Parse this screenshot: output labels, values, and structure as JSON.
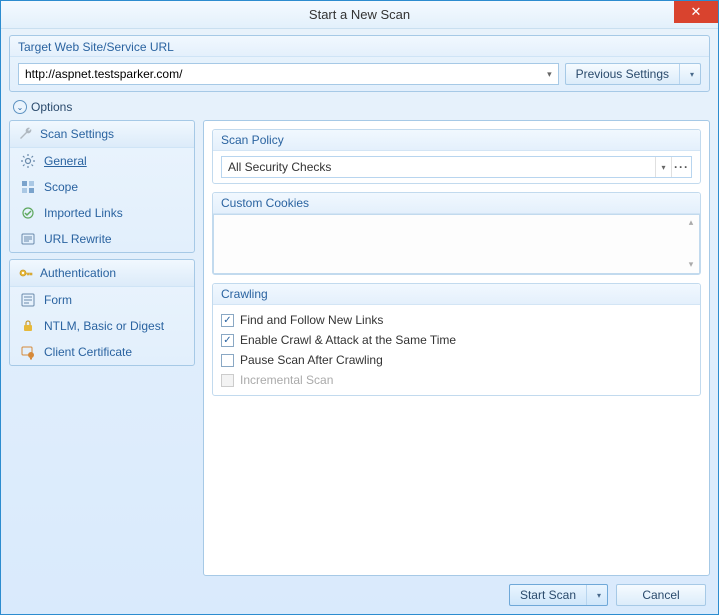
{
  "window": {
    "title": "Start a New Scan"
  },
  "target": {
    "label": "Target Web Site/Service URL",
    "url": "http://aspnet.testsparker.com/",
    "previous_settings_label": "Previous Settings"
  },
  "options": {
    "toggle_label": "Options"
  },
  "sidebar": {
    "scan_settings": {
      "header": "Scan Settings",
      "items": [
        {
          "label": "General",
          "icon": "gear-icon",
          "active": true
        },
        {
          "label": "Scope",
          "icon": "scope-icon"
        },
        {
          "label": "Imported Links",
          "icon": "links-icon"
        },
        {
          "label": "URL Rewrite",
          "icon": "rewrite-icon"
        }
      ]
    },
    "authentication": {
      "header": "Authentication",
      "items": [
        {
          "label": "Form",
          "icon": "form-icon"
        },
        {
          "label": "NTLM, Basic or Digest",
          "icon": "lock-icon"
        },
        {
          "label": "Client Certificate",
          "icon": "certificate-icon"
        }
      ]
    }
  },
  "scan_policy": {
    "header": "Scan Policy",
    "value": "All Security Checks"
  },
  "custom_cookies": {
    "header": "Custom Cookies",
    "value": ""
  },
  "crawling": {
    "header": "Crawling",
    "options": [
      {
        "label": "Find and Follow New Links",
        "checked": true,
        "disabled": false
      },
      {
        "label": "Enable Crawl & Attack at the Same Time",
        "checked": true,
        "disabled": false
      },
      {
        "label": "Pause Scan After Crawling",
        "checked": false,
        "disabled": false
      },
      {
        "label": "Incremental Scan",
        "checked": false,
        "disabled": true
      }
    ]
  },
  "footer": {
    "start_scan_label": "Start Scan",
    "cancel_label": "Cancel"
  }
}
